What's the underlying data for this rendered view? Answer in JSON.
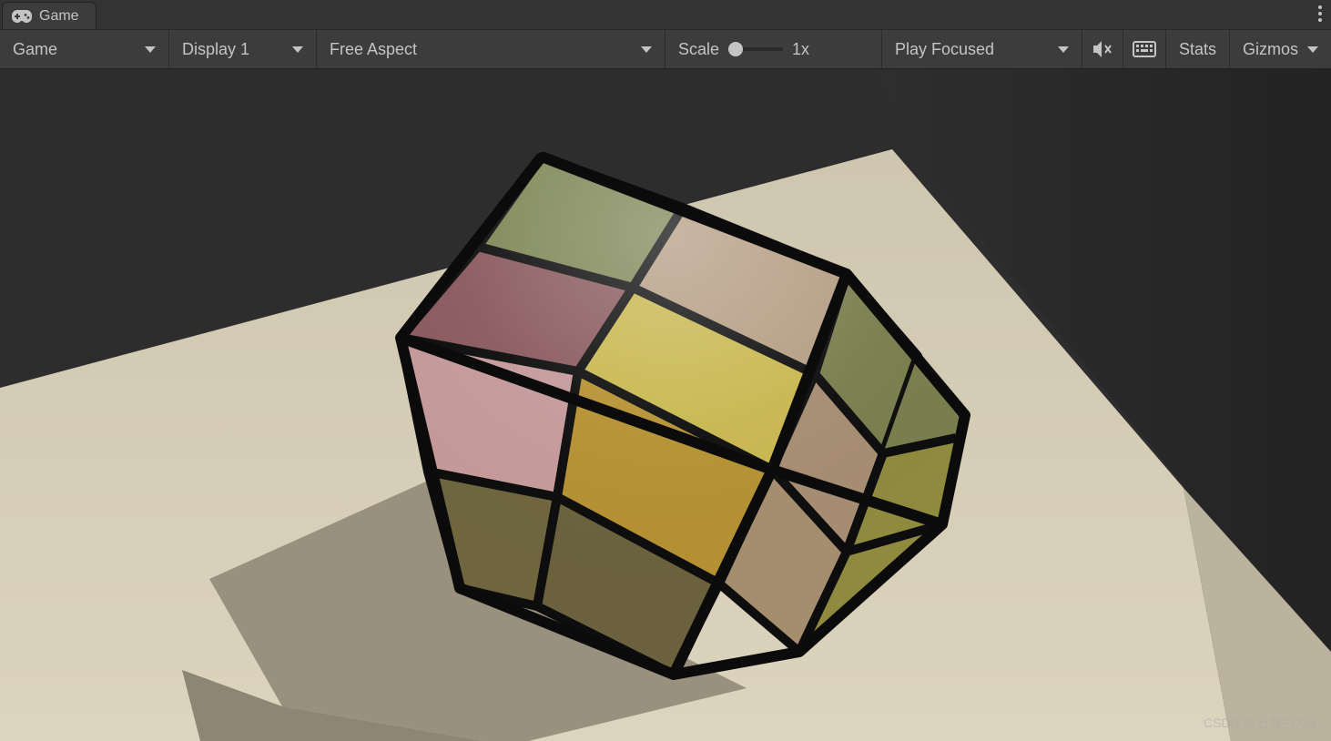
{
  "tab": {
    "label": "Game"
  },
  "toolbar": {
    "view_mode": "Game",
    "display": "Display 1",
    "aspect": "Free Aspect",
    "scale_label": "Scale",
    "scale_value": "1x",
    "play_mode": "Play Focused",
    "stats_label": "Stats",
    "gizmos_label": "Gizmos"
  },
  "scene": {
    "bg_upper": "#2d2d2d",
    "bg_wall_shadow": "#1f1f1f",
    "floor_light": "#d8cfb9",
    "floor_shadow": "#bdb49e",
    "cube_shadow": "#99917e",
    "cube_shadow_dark": "#8a8372",
    "outline": "#0f0f0f",
    "top_a": "#7d8655",
    "top_b": "#b49c82",
    "top_c": "#8a5a5e",
    "top_d": "#c8b74f",
    "left_a": "#c59a9b",
    "left_b": "#a6832f",
    "left_c": "#6f6640",
    "left_d": "#6b623d",
    "right_a": "#7a7e4e",
    "right_b": "#a68d72",
    "right_c": "#a58e6e",
    "right_d": "#8f8a3e"
  },
  "watermark": "CSDN @万有引力w"
}
